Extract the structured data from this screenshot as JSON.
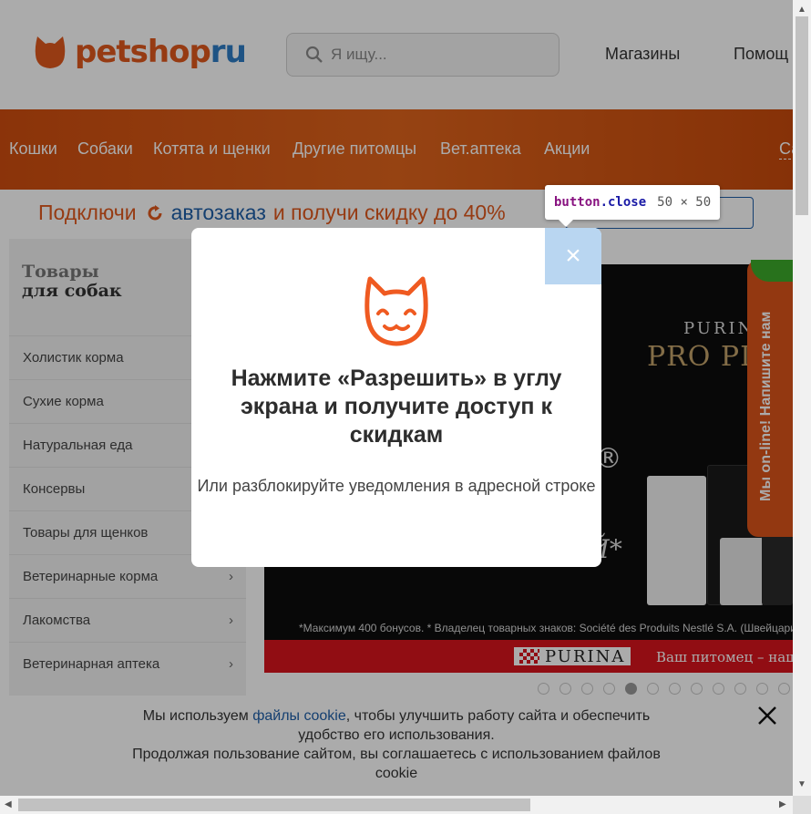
{
  "header": {
    "logo": {
      "part1": "petshop",
      "part2": "ru"
    },
    "search": {
      "placeholder": "Я ищу..."
    },
    "links": [
      "Магазины",
      "Помощ"
    ]
  },
  "nav": {
    "items": [
      "Кошки",
      "Собаки",
      "Котята и щенки",
      "Другие питомцы",
      "Вет.аптека",
      "Акции",
      "Са"
    ]
  },
  "promo": {
    "prefix": "Подключи",
    "highlight": "автозаказ",
    "suffix": "и получи скидку до 40%"
  },
  "sidebar": {
    "title_line1": "Товары",
    "title_line2": "для собак",
    "items": [
      {
        "label": "Холистик корма"
      },
      {
        "label": "Сухие корма"
      },
      {
        "label": "Натуральная еда"
      },
      {
        "label": "Консервы"
      },
      {
        "label": "Товары для щенков"
      },
      {
        "label": "Ветеринарные корма",
        "chevron": "›"
      },
      {
        "label": "Лакомства",
        "chevron": "›"
      },
      {
        "label": "Ветеринарная аптека",
        "chevron": "›"
      }
    ]
  },
  "banner": {
    "brand_top": "PURINA",
    "brand": "PRO PL",
    "partial_line1": "N®",
    "partial_line2": "ЙЙ*",
    "footnote": "*Максимум 400 бонусов. * Владелец товарных знаков: Société des Produits Nestlé S.A. (Швейцария)",
    "strip_logo": "PURINA",
    "strip_text": "Ваш питомец – наш",
    "slides_count": 12,
    "active_slide": 5
  },
  "chat": {
    "label": "Мы on-line! Напишите нам"
  },
  "cookie": {
    "before_link": "Мы используем ",
    "link": "файлы cookie",
    "after_link": ", чтобы улучшить работу сайта и обеспечить удобство его использования.",
    "line2": "Продолжая пользование сайтом, вы соглашаетесь с использованием файлов cookie"
  },
  "modal": {
    "title": "Нажмите «Разрешить» в углу экрана и получите доступ к скидкам",
    "subtitle": "Или разблокируйте уведомления в адресной строке",
    "close_symbol": "×"
  },
  "devtools_tooltip": {
    "tag": "button",
    "class": ".close",
    "dims": "50 × 50"
  },
  "colors": {
    "brand_orange": "#e0581d",
    "brand_blue": "#2e7dc5",
    "nav_bg": "#d9581a",
    "chat_green": "#3dab2b",
    "purina_red": "#d8141d"
  }
}
